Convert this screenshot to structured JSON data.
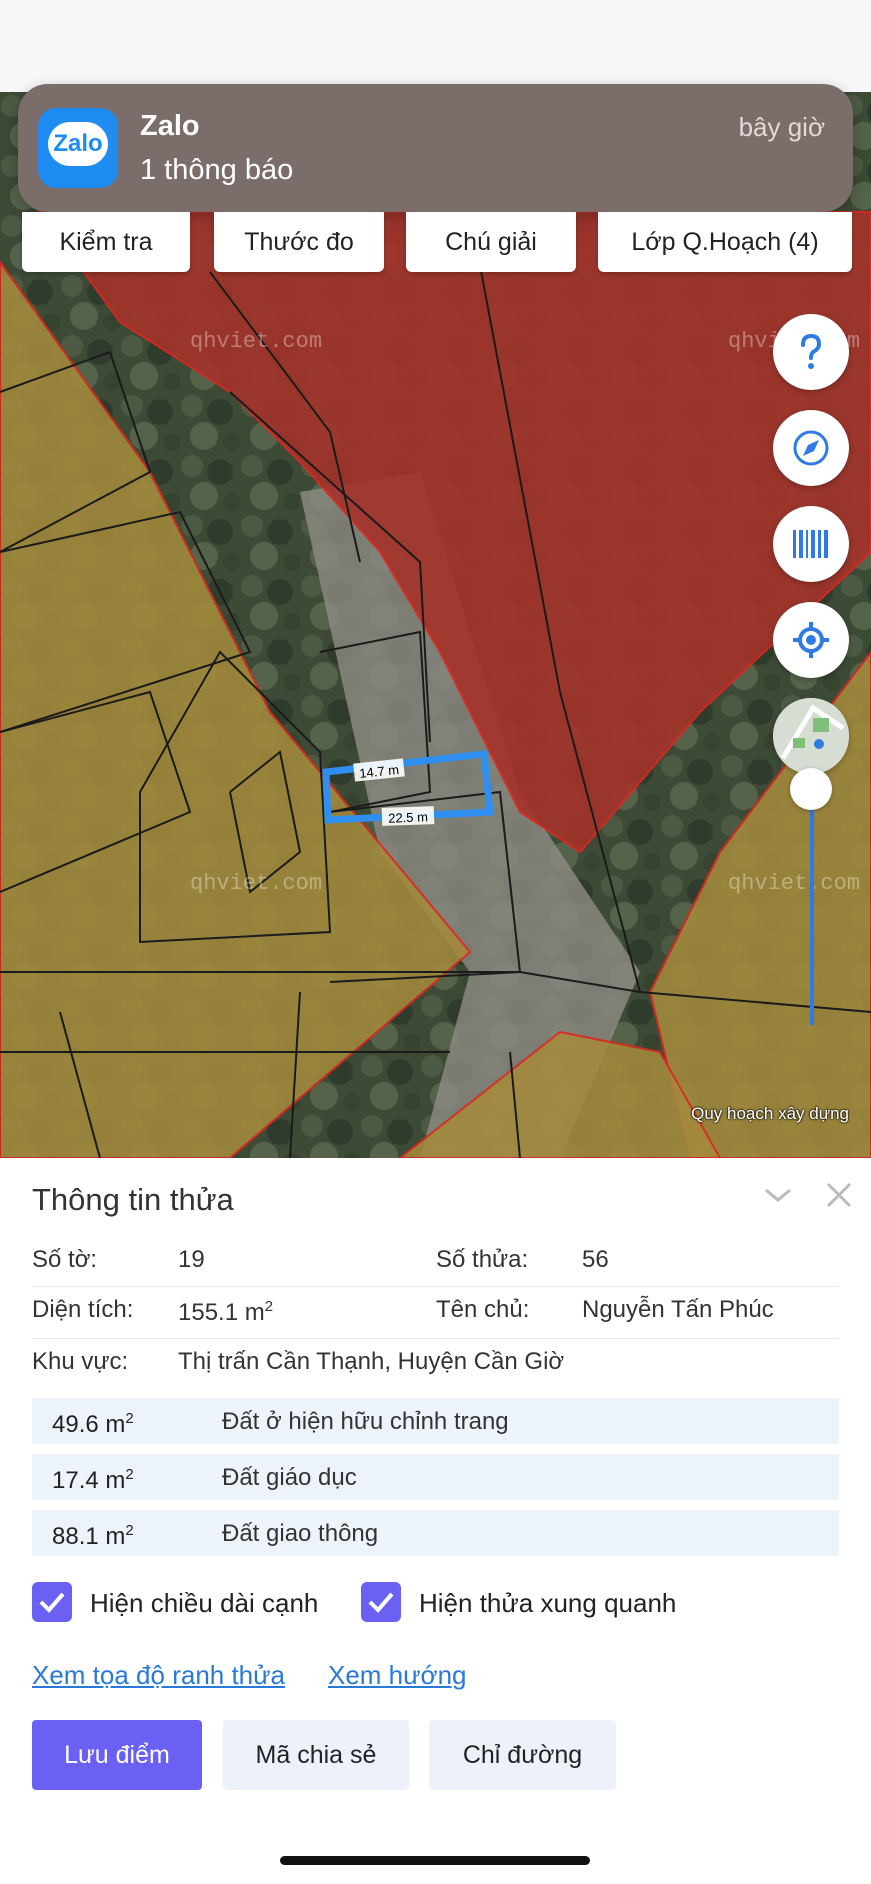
{
  "notification": {
    "app_name": "Zalo",
    "icon_text": "Zalo",
    "message": "1 thông báo",
    "time": "bây giờ"
  },
  "tabs": [
    "Kiểm tra",
    "Thước đo",
    "Chú giải",
    "Lớp Q.Hoạch (4)"
  ],
  "map": {
    "watermark": "qhviet.com",
    "edge_labels": [
      "14.7 m",
      "22.5 m"
    ],
    "attribution": "Quy hoạch xây dựng",
    "zoom_level": 0.05,
    "colors": {
      "red_zone": "#a4332a",
      "yellow_zone": "#a48a3c",
      "selected_parcel": "#2f8ff0",
      "accent": "#2f7ae5"
    }
  },
  "map_controls": {
    "buttons": [
      "help-icon",
      "compass-icon",
      "barcode-icon",
      "locate-icon"
    ]
  },
  "panel": {
    "title": "Thông tin thửa",
    "so_to_label": "Số tờ:",
    "so_to_value": "19",
    "so_thua_label": "Số thửa:",
    "so_thua_value": "56",
    "dien_tich_label": "Diện tích:",
    "dien_tich_value": "155.1 m",
    "ten_chu_label": "Tên chủ:",
    "ten_chu_value": "Nguyễn Tấn Phúc",
    "khu_vuc_label": "Khu vực:",
    "khu_vuc_value": "Thị trấn Cần Thạnh, Huyện Cần Giờ",
    "area_unit_sup": "2",
    "usages": [
      {
        "area": "49.6 m",
        "type": "Đất ở hiện hữu chỉnh trang"
      },
      {
        "area": "17.4 m",
        "type": "Đất giáo dục"
      },
      {
        "area": "88.1 m",
        "type": "Đất giao thông"
      }
    ],
    "checkboxes": [
      {
        "label": "Hiện chiều dài cạnh",
        "checked": true
      },
      {
        "label": "Hiện thửa xung quanh",
        "checked": true
      }
    ],
    "links": [
      "Xem tọa độ ranh thửa",
      "Xem hướng"
    ],
    "buttons": {
      "save": "Lưu điểm",
      "share": "Mã chia sẻ",
      "directions": "Chỉ đường"
    },
    "colors": {
      "primary_button": "#6a60f4",
      "secondary_button": "#edf1fa",
      "link": "#2979d9"
    }
  }
}
